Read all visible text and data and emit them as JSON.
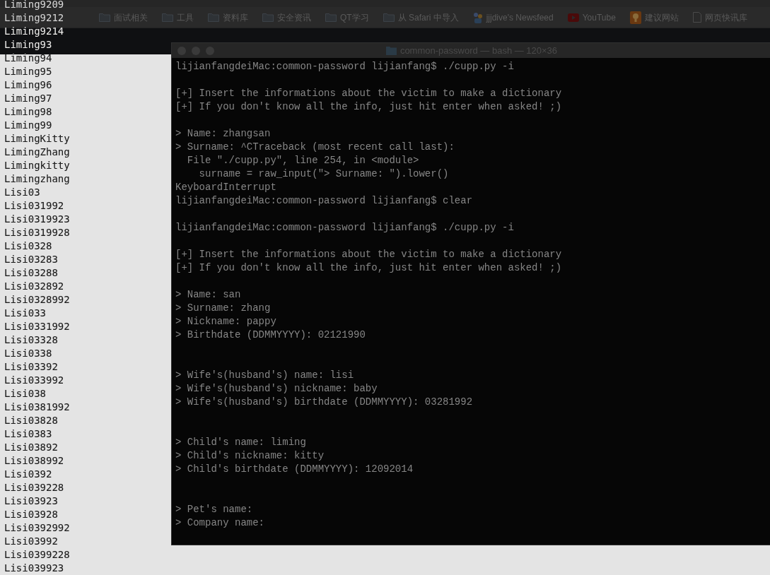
{
  "bookmarks_bar": {
    "items": [
      {
        "kind": "folder",
        "label": "面试相关"
      },
      {
        "kind": "folder",
        "label": "工具"
      },
      {
        "kind": "folder",
        "label": "资料库"
      },
      {
        "kind": "folder",
        "label": "安全资讯"
      },
      {
        "kind": "folder",
        "label": "QT学习"
      },
      {
        "kind": "folder",
        "label": "从 Safari 中导入"
      },
      {
        "kind": "feed",
        "label": "jjjdive's Newsfeed"
      },
      {
        "kind": "video",
        "label": "YouTube"
      },
      {
        "kind": "bulb",
        "label": "建议网站"
      },
      {
        "kind": "page",
        "label": "网页快讯库"
      }
    ]
  },
  "terminal": {
    "title": "common-password — bash — 120×36",
    "blocks": [
      {
        "double_gap": false,
        "lines": [
          "lijianfangdeiMac:common-password lijianfang$ ./cupp.py -i"
        ]
      },
      {
        "double_gap": false,
        "lines": [
          "[+] Insert the informations about the victim to make a dictionary",
          "[+] If you don't know all the info, just hit enter when asked! ;)"
        ]
      },
      {
        "double_gap": false,
        "lines": [
          "> Name: zhangsan",
          "> Surname: ^CTraceback (most recent call last):",
          "  File \"./cupp.py\", line 254, in <module>",
          "    surname = raw_input(\"> Surname: \").lower()",
          "KeyboardInterrupt",
          "lijianfangdeiMac:common-password lijianfang$ clear"
        ]
      },
      {
        "double_gap": false,
        "lines": [
          "lijianfangdeiMac:common-password lijianfang$ ./cupp.py -i"
        ]
      },
      {
        "double_gap": false,
        "lines": [
          "[+] Insert the informations about the victim to make a dictionary",
          "[+] If you don't know all the info, just hit enter when asked! ;)"
        ]
      },
      {
        "double_gap": true,
        "lines": [
          "> Name: san",
          "> Surname: zhang",
          "> Nickname: pappy",
          "> Birthdate (DDMMYYYY): 02121990"
        ]
      },
      {
        "double_gap": true,
        "lines": [
          "> Wife's(husband's) name: lisi",
          "> Wife's(husband's) nickname: baby",
          "> Wife's(husband's) birthdate (DDMMYYYY): 03281992"
        ]
      },
      {
        "double_gap": true,
        "lines": [
          "> Child's name: liming",
          "> Child's nickname: kitty",
          "> Child's birthdate (DDMMYYYY): 12092014"
        ]
      },
      {
        "double_gap": false,
        "lines": [
          "> Pet's name:",
          "> Company name:"
        ]
      }
    ]
  },
  "wordlist": [
    "Liming9209",
    "Liming9212",
    "Liming9214",
    "Liming93",
    "Liming94",
    "Liming95",
    "Liming96",
    "Liming97",
    "Liming98",
    "Liming99",
    "LimingKitty",
    "LimingZhang",
    "Limingkitty",
    "Limingzhang",
    "Lisi03",
    "Lisi031992",
    "Lisi0319923",
    "Lisi0319928",
    "Lisi0328",
    "Lisi03283",
    "Lisi03288",
    "Lisi032892",
    "Lisi0328992",
    "Lisi033",
    "Lisi0331992",
    "Lisi03328",
    "Lisi0338",
    "Lisi03392",
    "Lisi033992",
    "Lisi038",
    "Lisi0381992",
    "Lisi03828",
    "Lisi0383",
    "Lisi03892",
    "Lisi038992",
    "Lisi0392",
    "Lisi039228",
    "Lisi03923",
    "Lisi03928",
    "Lisi0392992",
    "Lisi03992",
    "Lisi0399228",
    "Lisi039923"
  ]
}
